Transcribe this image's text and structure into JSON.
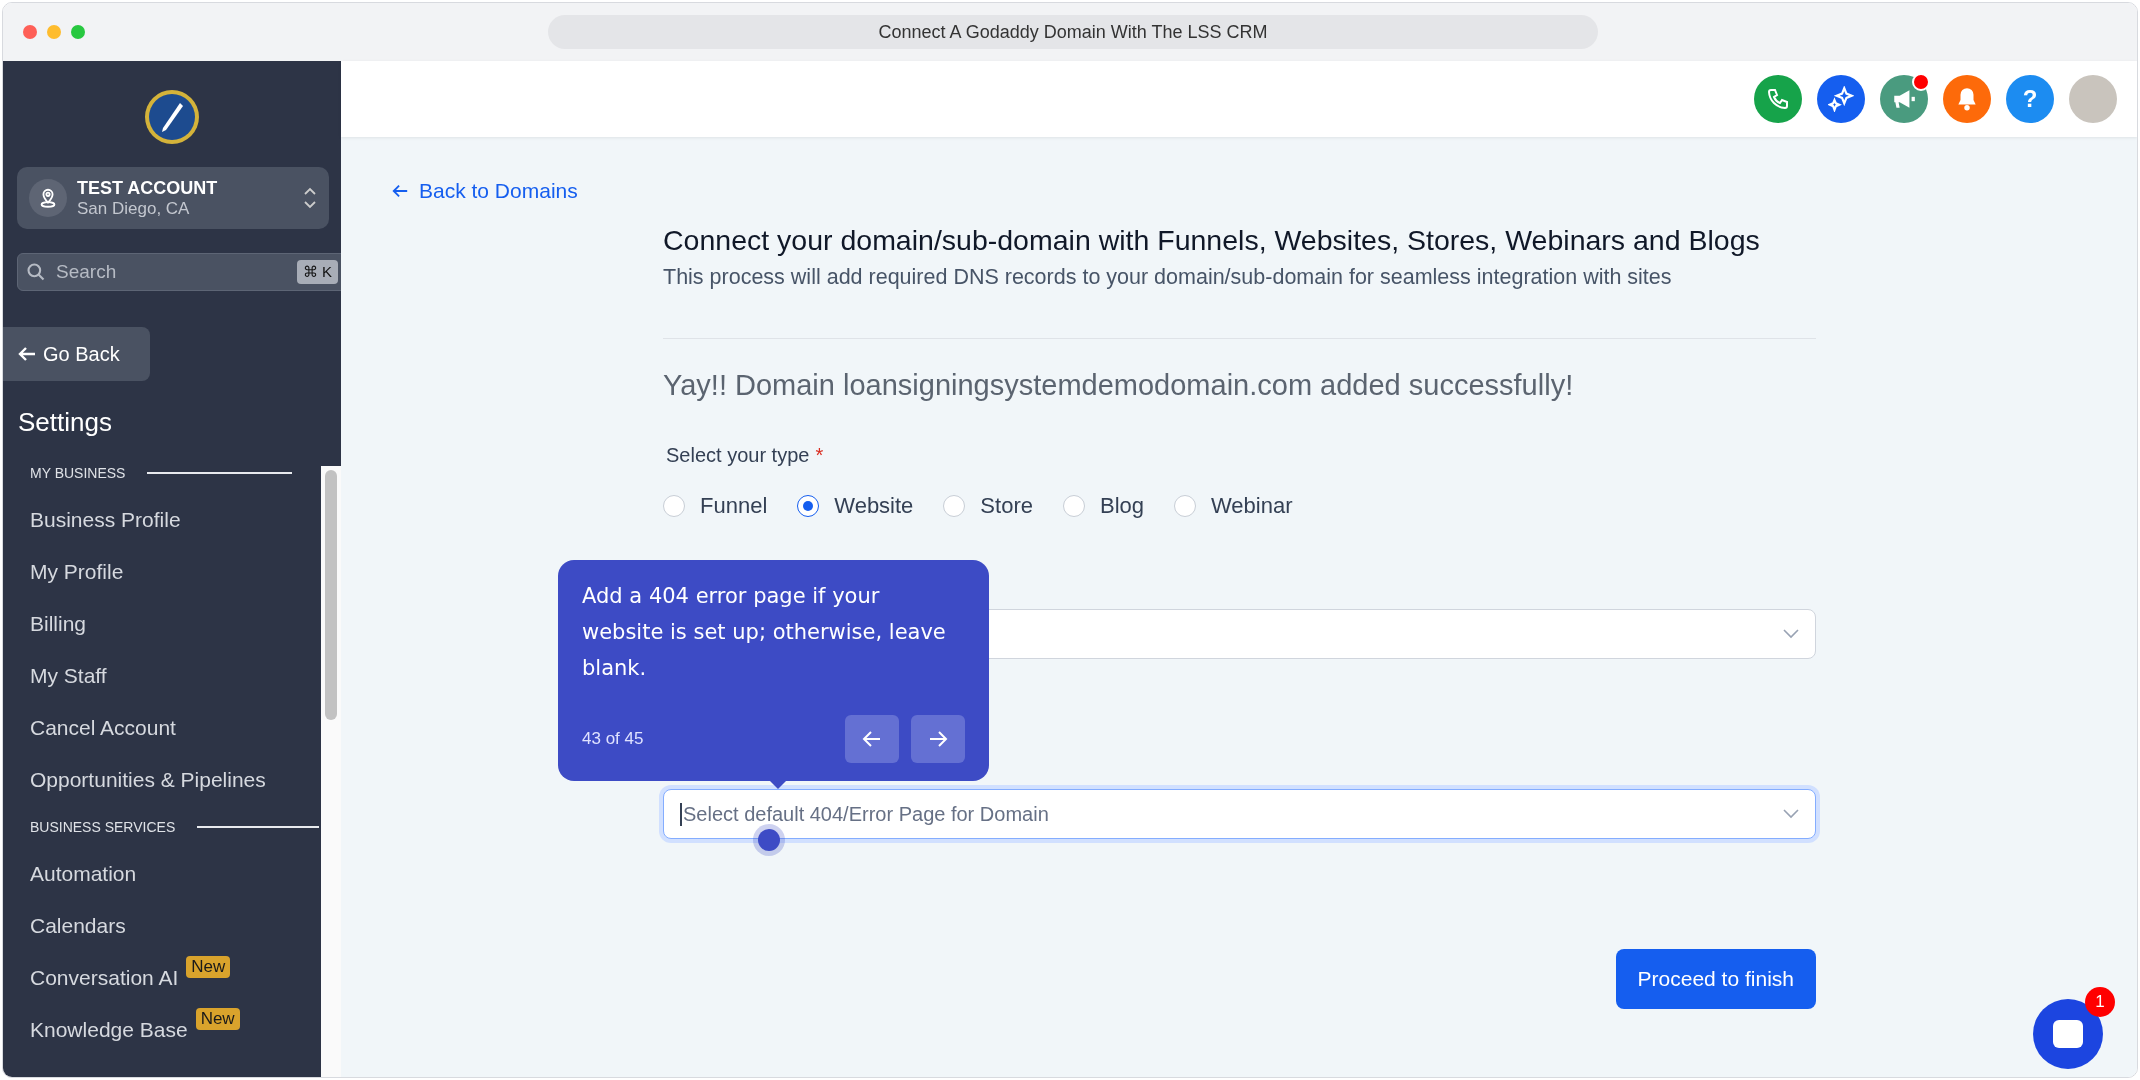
{
  "window": {
    "title": "Connect A Godaddy Domain With The LSS CRM"
  },
  "sidebar": {
    "account": {
      "name": "TEST ACCOUNT",
      "location": "San Diego, CA"
    },
    "search": {
      "placeholder": "Search",
      "shortcut": "⌘ K"
    },
    "go_back": "Go Back",
    "heading": "Settings",
    "sections": [
      {
        "title": "MY BUSINESS",
        "items": [
          {
            "label": "Business Profile"
          },
          {
            "label": "My Profile"
          },
          {
            "label": "Billing"
          },
          {
            "label": "My Staff"
          },
          {
            "label": "Cancel Account"
          },
          {
            "label": "Opportunities & Pipelines"
          }
        ]
      },
      {
        "title": "BUSINESS SERVICES",
        "items": [
          {
            "label": "Automation"
          },
          {
            "label": "Calendars"
          },
          {
            "label": "Conversation AI",
            "badge": "New"
          },
          {
            "label": "Knowledge Base",
            "badge": "New"
          }
        ]
      }
    ]
  },
  "header": {
    "icons": [
      {
        "kind": "phone",
        "unread": false
      },
      {
        "kind": "sparkle",
        "unread": false
      },
      {
        "kind": "megaphone",
        "unread": true
      },
      {
        "kind": "bell",
        "unread": false
      },
      {
        "kind": "help",
        "label": "?",
        "unread": false
      },
      {
        "kind": "avatar",
        "unread": false
      }
    ]
  },
  "page": {
    "back_link": "Back to Domains",
    "title": "Connect your domain/sub-domain with Funnels, Websites, Stores, Webinars and Blogs",
    "subtitle": "This process will add required DNS records to your domain/sub-domain for seamless integration with sites",
    "success_message": "Yay!! Domain loansigningsystemdemodomain.com added successfully!",
    "type_label": "Select your type",
    "required_mark": "*",
    "types": [
      {
        "label": "Funnel",
        "selected": false
      },
      {
        "label": "Website",
        "selected": true
      },
      {
        "label": "Store",
        "selected": false
      },
      {
        "label": "Blog",
        "selected": false
      },
      {
        "label": "Webinar",
        "selected": false
      }
    ],
    "fields": [
      {
        "focused": false
      },
      {
        "placeholder": "Select default 404/Error Page for Domain",
        "focused": true
      }
    ],
    "submit_button": "Proceed to finish"
  },
  "tooltip": {
    "text": "Add a 404 error page if your website is set up; otherwise, leave blank.",
    "step": "43 of 45"
  },
  "chat": {
    "badge": "1"
  }
}
